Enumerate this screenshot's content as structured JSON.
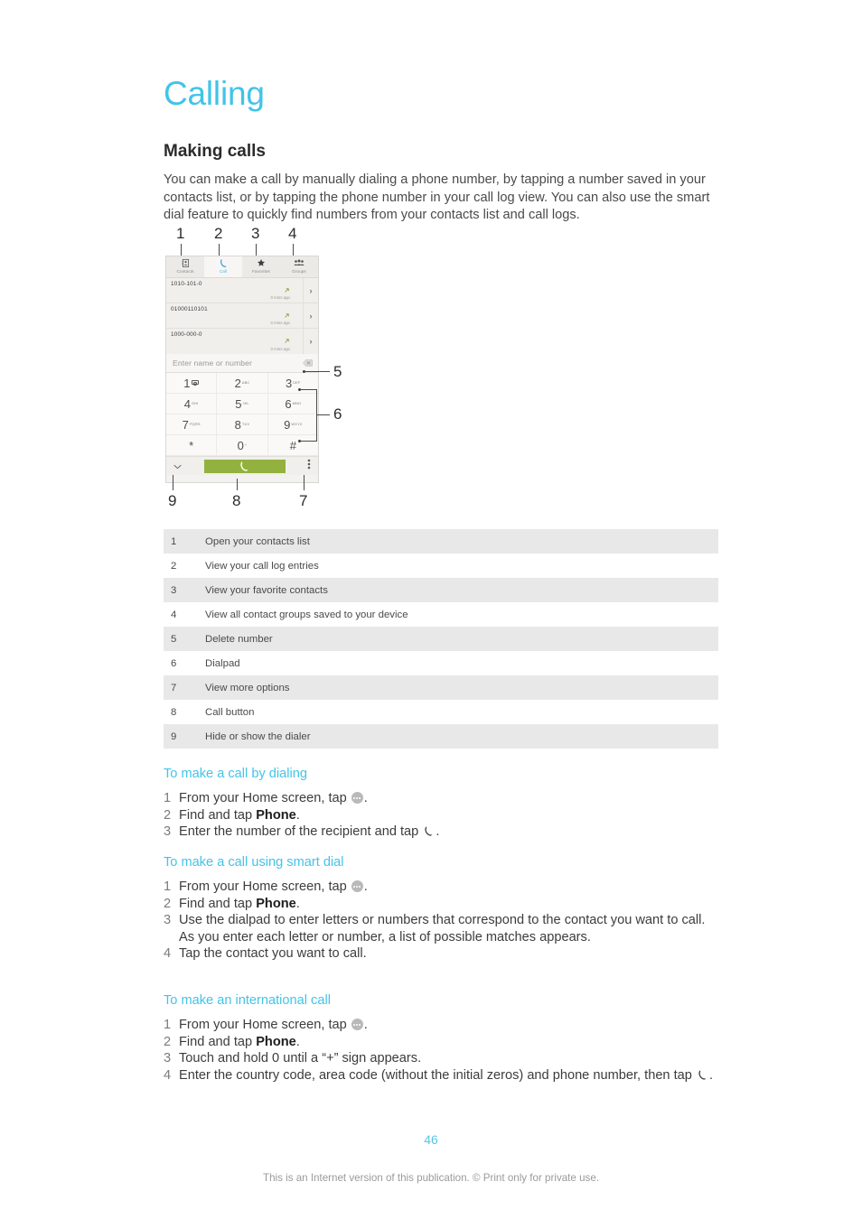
{
  "document": {
    "chapter_title": "Calling",
    "section_title": "Making calls",
    "intro_paragraph": "You can make a call by manually dialing a phone number, by tapping a number saved in your contacts list, or by tapping the phone number in your call log view. You can also use the smart dial feature to quickly find numbers from your contacts list and call logs.",
    "page_number": "46",
    "footer_note": "This is an Internet version of this publication. © Print only for private use."
  },
  "colors": {
    "accent_cyan": "#41c4e8",
    "call_button_green": "#93b13f",
    "table_shade": "#e8e8e8",
    "body_text": "#3c3c3c"
  },
  "figure": {
    "callouts": [
      "1",
      "2",
      "3",
      "4",
      "5",
      "6",
      "7",
      "8",
      "9"
    ],
    "phone": {
      "tabs": [
        {
          "label": "Contacts",
          "icon": "contacts-icon",
          "active": false
        },
        {
          "label": "Call",
          "icon": "handset-icon",
          "active": true
        },
        {
          "label": "Favorites",
          "icon": "star-icon",
          "active": false
        },
        {
          "label": "Groups",
          "icon": "groups-icon",
          "active": false
        }
      ],
      "call_log": [
        {
          "number": "1010-101-0",
          "time": "0 mins ago",
          "direction_icon": "outgoing-call-arrow-icon"
        },
        {
          "number": "01000110101",
          "time": "0 mins ago",
          "direction_icon": "outgoing-call-arrow-icon"
        },
        {
          "number": "1000-000-0",
          "time": "0 mins ago",
          "direction_icon": "outgoing-call-arrow-icon"
        }
      ],
      "input_placeholder": "Enter name or number",
      "delete_icon": "backspace-delete-icon",
      "dialpad": [
        [
          {
            "digit": "1",
            "sub": "",
            "icon": "voicemail-icon"
          },
          {
            "digit": "2",
            "sub": "ABC"
          },
          {
            "digit": "3",
            "sub": "DEF"
          }
        ],
        [
          {
            "digit": "4",
            "sub": "GHI"
          },
          {
            "digit": "5",
            "sub": "JKL"
          },
          {
            "digit": "6",
            "sub": "MNO"
          }
        ],
        [
          {
            "digit": "7",
            "sub": "PQRS"
          },
          {
            "digit": "8",
            "sub": "TUV"
          },
          {
            "digit": "9",
            "sub": "WXYZ"
          }
        ],
        [
          {
            "digit": "*",
            "sub": ""
          },
          {
            "digit": "0",
            "sub": "+"
          },
          {
            "digit": "#",
            "sub": ""
          }
        ]
      ],
      "bottom_bar": {
        "hide_dialer_icon": "chevron-down-icon",
        "call_button_icon": "handset-icon",
        "more_options_icon": "overflow-menu-icon"
      }
    }
  },
  "legend": {
    "rows": [
      {
        "num": "1",
        "text": "Open your contacts list"
      },
      {
        "num": "2",
        "text": "View your call log entries"
      },
      {
        "num": "3",
        "text": "View your favorite contacts"
      },
      {
        "num": "4",
        "text": "View all contact groups saved to your device"
      },
      {
        "num": "5",
        "text": "Delete number"
      },
      {
        "num": "6",
        "text": "Dialpad"
      },
      {
        "num": "7",
        "text": "View more options"
      },
      {
        "num": "8",
        "text": "Call button"
      },
      {
        "num": "9",
        "text": "Hide or show the dialer"
      }
    ]
  },
  "procedures": [
    {
      "heading": "To make a call by dialing",
      "steps": [
        {
          "num": "1",
          "prefix": "From your Home screen, tap ",
          "icon": "app-drawer-icon",
          "suffix": "."
        },
        {
          "num": "2",
          "prefix": "Find and tap ",
          "bold": "Phone",
          "suffix": "."
        },
        {
          "num": "3",
          "prefix": "Enter the number of the recipient and tap ",
          "icon": "handset-icon",
          "suffix": "."
        }
      ]
    },
    {
      "heading": "To make a call using smart dial",
      "steps": [
        {
          "num": "1",
          "prefix": "From your Home screen, tap ",
          "icon": "app-drawer-icon",
          "suffix": "."
        },
        {
          "num": "2",
          "prefix": "Find and tap ",
          "bold": "Phone",
          "suffix": "."
        },
        {
          "num": "3",
          "prefix": "Use the dialpad to enter letters or numbers that correspond to the contact you want to call. As you enter each letter or number, a list of possible matches appears.",
          "suffix": ""
        },
        {
          "num": "4",
          "prefix": "Tap the contact you want to call.",
          "suffix": ""
        }
      ]
    },
    {
      "heading": "To make an international call",
      "steps": [
        {
          "num": "1",
          "prefix": "From your Home screen, tap ",
          "icon": "app-drawer-icon",
          "suffix": "."
        },
        {
          "num": "2",
          "prefix": "Find and tap ",
          "bold": "Phone",
          "suffix": "."
        },
        {
          "num": "3",
          "prefix": "Touch and hold 0 until a “+” sign appears.",
          "suffix": ""
        },
        {
          "num": "4",
          "prefix": "Enter the country code, area code (without the initial zeros) and phone number, then tap ",
          "icon": "handset-icon",
          "suffix": "."
        }
      ]
    }
  ]
}
